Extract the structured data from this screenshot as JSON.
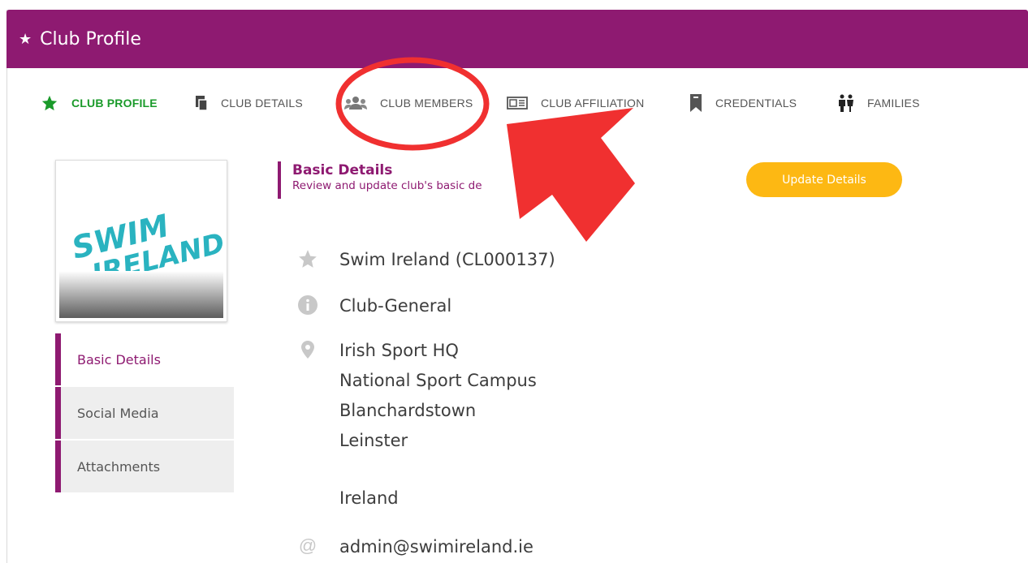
{
  "header": {
    "title": "Club Profile",
    "star_icon": "star-icon"
  },
  "tabs": [
    {
      "label": "CLUB PROFILE",
      "icon": "star-icon",
      "active": true
    },
    {
      "label": "CLUB DETAILS",
      "icon": "document-icon",
      "active": false
    },
    {
      "label": "CLUB MEMBERS",
      "icon": "users-icon",
      "active": false
    },
    {
      "label": "CLUB AFFILIATION",
      "icon": "id-card-icon",
      "active": false
    },
    {
      "label": "CREDENTIALS",
      "icon": "bookmark-icon",
      "active": false
    },
    {
      "label": "FAMILIES",
      "icon": "family-icon",
      "active": false
    }
  ],
  "logo": {
    "line1": "SWIM",
    "line2": "IRELAND"
  },
  "side_nav": [
    {
      "label": "Basic Details",
      "active": true
    },
    {
      "label": "Social Media",
      "active": false
    },
    {
      "label": "Attachments",
      "active": false
    }
  ],
  "section": {
    "title": "Basic Details",
    "subtitle": "Review and update club's basic de"
  },
  "update_button": "Update Details",
  "details": {
    "name": "Swim Ireland (CL000137)",
    "type": "Club-General",
    "address": [
      "Irish Sport HQ",
      "National Sport Campus",
      "Blanchardstown",
      "Leinster",
      "",
      "Ireland"
    ],
    "email": "admin@swimireland.ie"
  },
  "colors": {
    "brand": "#8e1a71",
    "active_tab": "#1a9a2a",
    "button": "#fdb813",
    "annotation": "#f03030"
  }
}
